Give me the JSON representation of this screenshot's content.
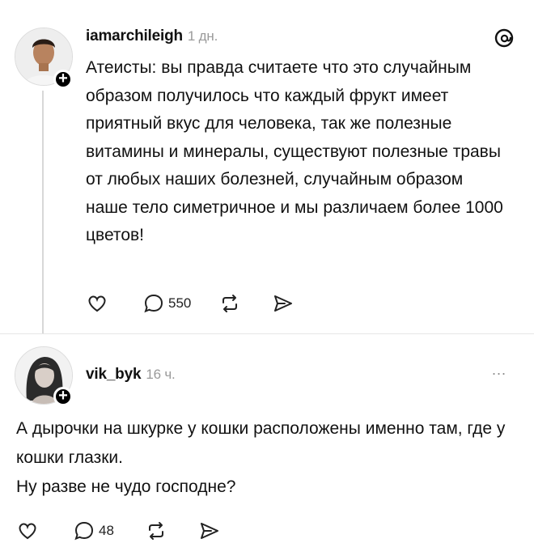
{
  "post1": {
    "username": "iamarchileigh",
    "time": "1 дн.",
    "text": "Атеисты: вы правда считаете что это случайным образом получилось что каждый фрукт имеет приятный вкус для человека, так же полезные витамины и минералы, существуют полезные травы от любых наших болезней, случайным образом наше тело симетричное и мы различаем более 1000 цветов!",
    "reply_count": "550",
    "plus_label": "+",
    "app_icon": "threads-logo-icon"
  },
  "post2": {
    "username": "vik_byk",
    "time": "16 ч.",
    "line1": "А дырочки на шкурке у кошки расположены именно там, где у кошки глазки.",
    "line2": "Ну разве не чудо господне?",
    "reply_count": "48",
    "more_label": "...",
    "plus_label": "+"
  }
}
